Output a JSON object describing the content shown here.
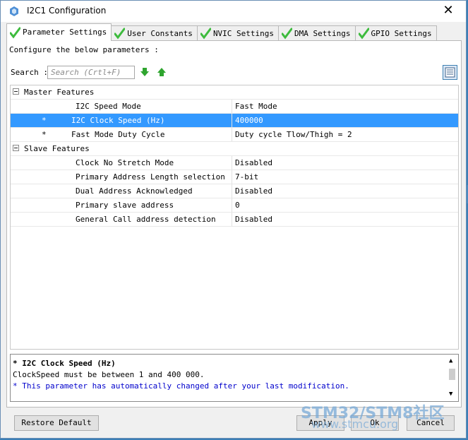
{
  "window": {
    "title": "I2C1 Configuration",
    "close_glyph": "✕"
  },
  "tabs": [
    {
      "label": "Parameter Settings",
      "active": true
    },
    {
      "label": "User Constants",
      "active": false
    },
    {
      "label": "NVIC Settings",
      "active": false
    },
    {
      "label": "DMA Settings",
      "active": false
    },
    {
      "label": "GPIO Settings",
      "active": false
    }
  ],
  "panel": {
    "instructions": "Configure the below parameters :",
    "search_label": "Search :",
    "search_placeholder": "Search (Crtl+F)"
  },
  "groups": {
    "master": {
      "label": "Master Features",
      "rows": [
        {
          "star": "",
          "name": "I2C Speed Mode",
          "value": "Fast Mode"
        },
        {
          "star": "*",
          "name": "I2C Clock Speed (Hz)",
          "value": "400000",
          "selected": true
        },
        {
          "star": "*",
          "name": "Fast Mode Duty Cycle",
          "value": "Duty cycle Tlow/Thigh = 2"
        }
      ]
    },
    "slave": {
      "label": "Slave Features",
      "rows": [
        {
          "name": "Clock No Stretch Mode",
          "value": "Disabled"
        },
        {
          "name": "Primary Address Length selection",
          "value": "7-bit"
        },
        {
          "name": "Dual Address Acknowledged",
          "value": "Disabled"
        },
        {
          "name": "Primary slave address",
          "value": "0"
        },
        {
          "name": "General Call address detection",
          "value": "Disabled"
        }
      ]
    }
  },
  "description": {
    "title": "* I2C Clock Speed (Hz)",
    "line2": "ClockSpeed must be between 1 and 400 000.",
    "line3": "* This parameter has automatically changed after your last modification."
  },
  "buttons": {
    "restore": "Restore Default",
    "apply": "Apply",
    "ok": "Ok",
    "cancel": "Cancel"
  },
  "watermark": {
    "line1": "STM32/STM8社区",
    "line2": "www.stmcu.org"
  },
  "colors": {
    "selection": "#3399ff",
    "check_green": "#3dbb3d",
    "arrow_green": "#2fa52f",
    "desc_blue": "#0000cc"
  }
}
